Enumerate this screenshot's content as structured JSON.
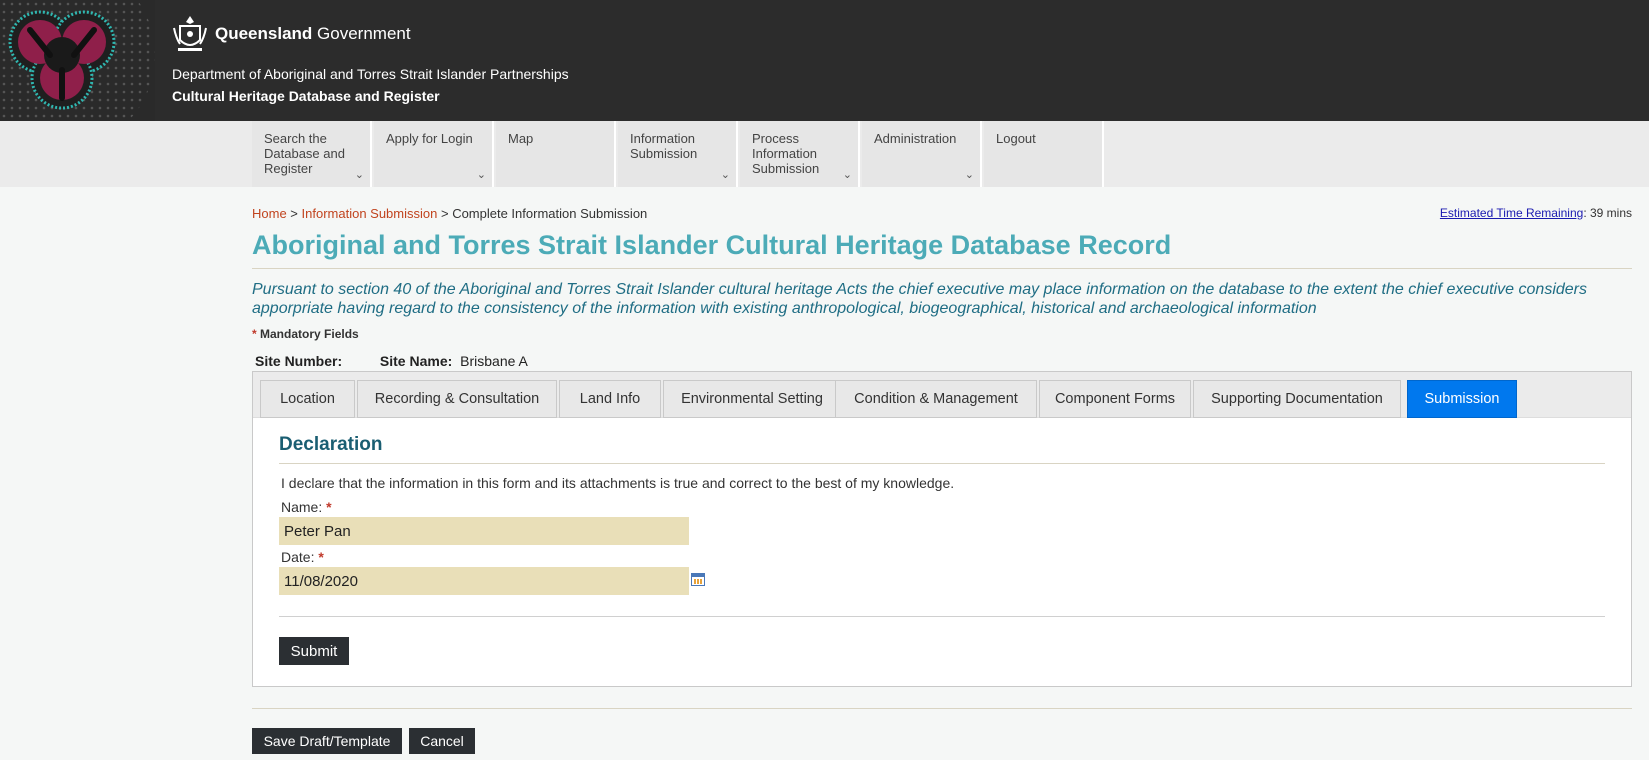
{
  "header": {
    "qld_bold": "Queensland",
    "qld_rest": " Government",
    "department": "Department of Aboriginal and Torres Strait Islander Partnerships",
    "app_name": "Cultural Heritage Database and Register",
    "logo_icon": "indigenous-artwork-logo",
    "crest_icon": "qld-coat-of-arms-icon"
  },
  "nav": {
    "items": [
      {
        "label": "Search the Database and Register",
        "has_dropdown": true
      },
      {
        "label": "Apply for Login",
        "has_dropdown": true
      },
      {
        "label": "Map",
        "has_dropdown": false
      },
      {
        "label": "Information Submission",
        "has_dropdown": true
      },
      {
        "label": "Process Information Submission",
        "has_dropdown": true
      },
      {
        "label": "Administration",
        "has_dropdown": true
      },
      {
        "label": "Logout",
        "has_dropdown": false
      }
    ],
    "chevron": "⌄"
  },
  "breadcrumb": {
    "home": "Home",
    "sep1": " > ",
    "section": "Information Submission",
    "sep2": " > ",
    "current": "Complete Information Submission"
  },
  "time_remaining": {
    "link": "Estimated Time Remaining",
    "value": ": 39 mins"
  },
  "page_title": "Aboriginal and Torres Strait Islander Cultural Heritage Database Record",
  "intro": "Pursuant to section 40 of the Aboriginal and Torres Strait Islander cultural heritage Acts the chief executive may place information on the database to the extent the chief executive considers apporpriate having regard to the consistency of the information with existing anthropological, biogeographical, historical and archaeological information",
  "mandatory": {
    "asterisk": "*",
    "label": "Mandatory Fields"
  },
  "site": {
    "number_label": "Site Number:",
    "number_value": "",
    "name_label": "Site Name:",
    "name_value": "Brisbane A"
  },
  "tabs": [
    {
      "label": "Location",
      "active": false
    },
    {
      "label": "Recording & Consultation",
      "active": false
    },
    {
      "label": "Land Info",
      "active": false
    },
    {
      "label": "Environmental Setting",
      "active": false
    },
    {
      "label": "Condition & Management",
      "active": false
    },
    {
      "label": "Component Forms",
      "active": false
    },
    {
      "label": "Supporting Documentation",
      "active": false
    },
    {
      "label": "Submission",
      "active": true
    }
  ],
  "declaration": {
    "title": "Declaration",
    "text": "I declare that the information in this form and its attachments is true and correct to the best of my knowledge.",
    "name_label": "Name:",
    "name_value": "Peter Pan",
    "date_label": "Date:",
    "date_value": "11/08/2020",
    "required_marker": "*",
    "calendar_icon": "calendar-icon",
    "submit_label": "Submit"
  },
  "footer_buttons": {
    "save_label": "Save Draft/Template",
    "cancel_label": "Cancel"
  },
  "colors": {
    "header_bg": "#2c2c2c",
    "title": "#4cabb7",
    "intro": "#1f6d84",
    "breadcrumb_link": "#c1441f",
    "active_tab": "#0078ee",
    "input_bg": "#e9dfb8",
    "button_bg": "#2b2f33"
  }
}
